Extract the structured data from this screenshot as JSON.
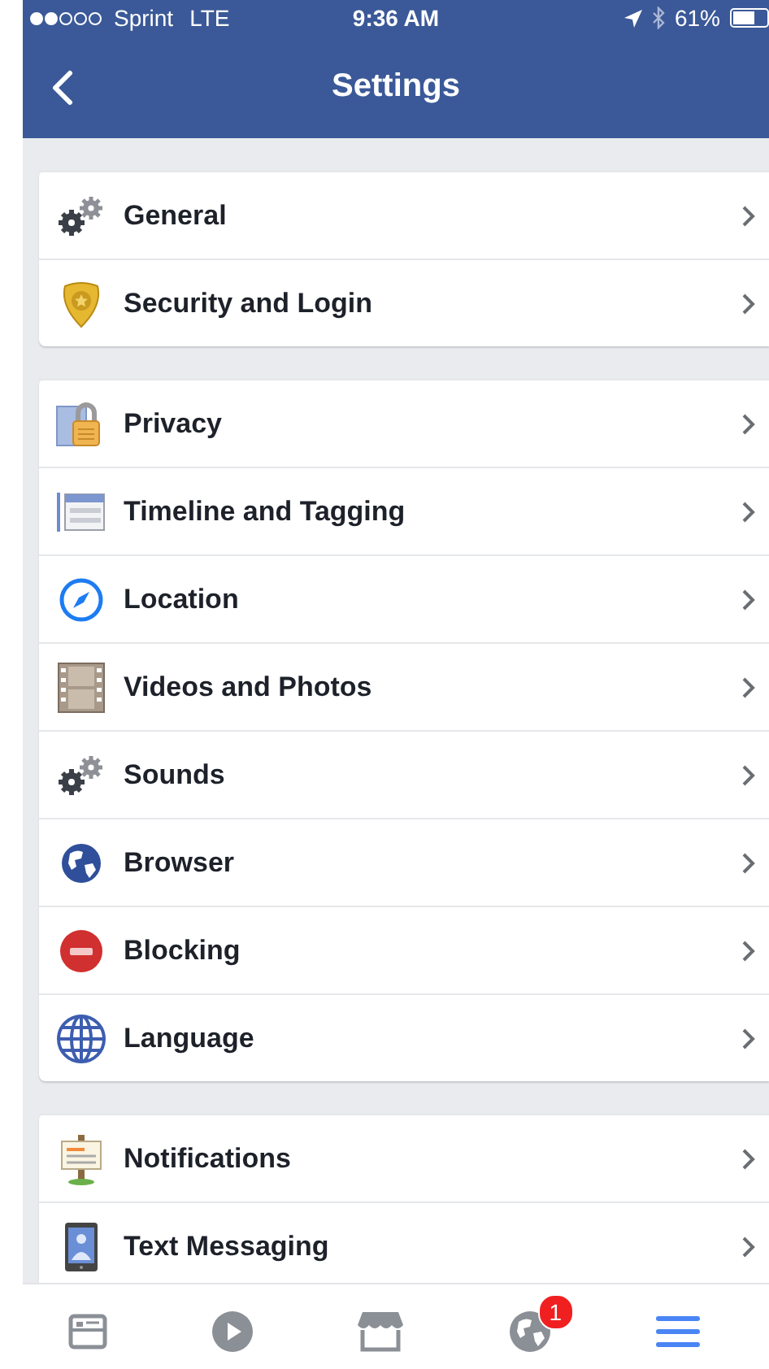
{
  "status_bar": {
    "carrier": "Sprint",
    "network": "LTE",
    "time": "9:36 AM",
    "battery": "61%"
  },
  "nav": {
    "title": "Settings"
  },
  "groups": [
    [
      {
        "label": "General",
        "kind": "gears"
      },
      {
        "label": "Security and Login",
        "kind": "badge"
      }
    ],
    [
      {
        "label": "Privacy",
        "kind": "lock"
      },
      {
        "label": "Timeline and Tagging",
        "kind": "timeline"
      },
      {
        "label": "Location",
        "kind": "compass"
      },
      {
        "label": "Videos and Photos",
        "kind": "film"
      },
      {
        "label": "Sounds",
        "kind": "gears"
      },
      {
        "label": "Browser",
        "kind": "globe"
      },
      {
        "label": "Blocking",
        "kind": "blocking"
      },
      {
        "label": "Language",
        "kind": "grid-globe"
      }
    ],
    [
      {
        "label": "Notifications",
        "kind": "sign"
      },
      {
        "label": "Text Messaging",
        "kind": "phone"
      }
    ]
  ],
  "tab_bar": [
    {
      "kind": "feed",
      "selected": false
    },
    {
      "kind": "video",
      "selected": false
    },
    {
      "kind": "shop",
      "selected": false
    },
    {
      "kind": "globe",
      "selected": false,
      "badge": "1"
    },
    {
      "kind": "menu",
      "selected": true
    }
  ]
}
